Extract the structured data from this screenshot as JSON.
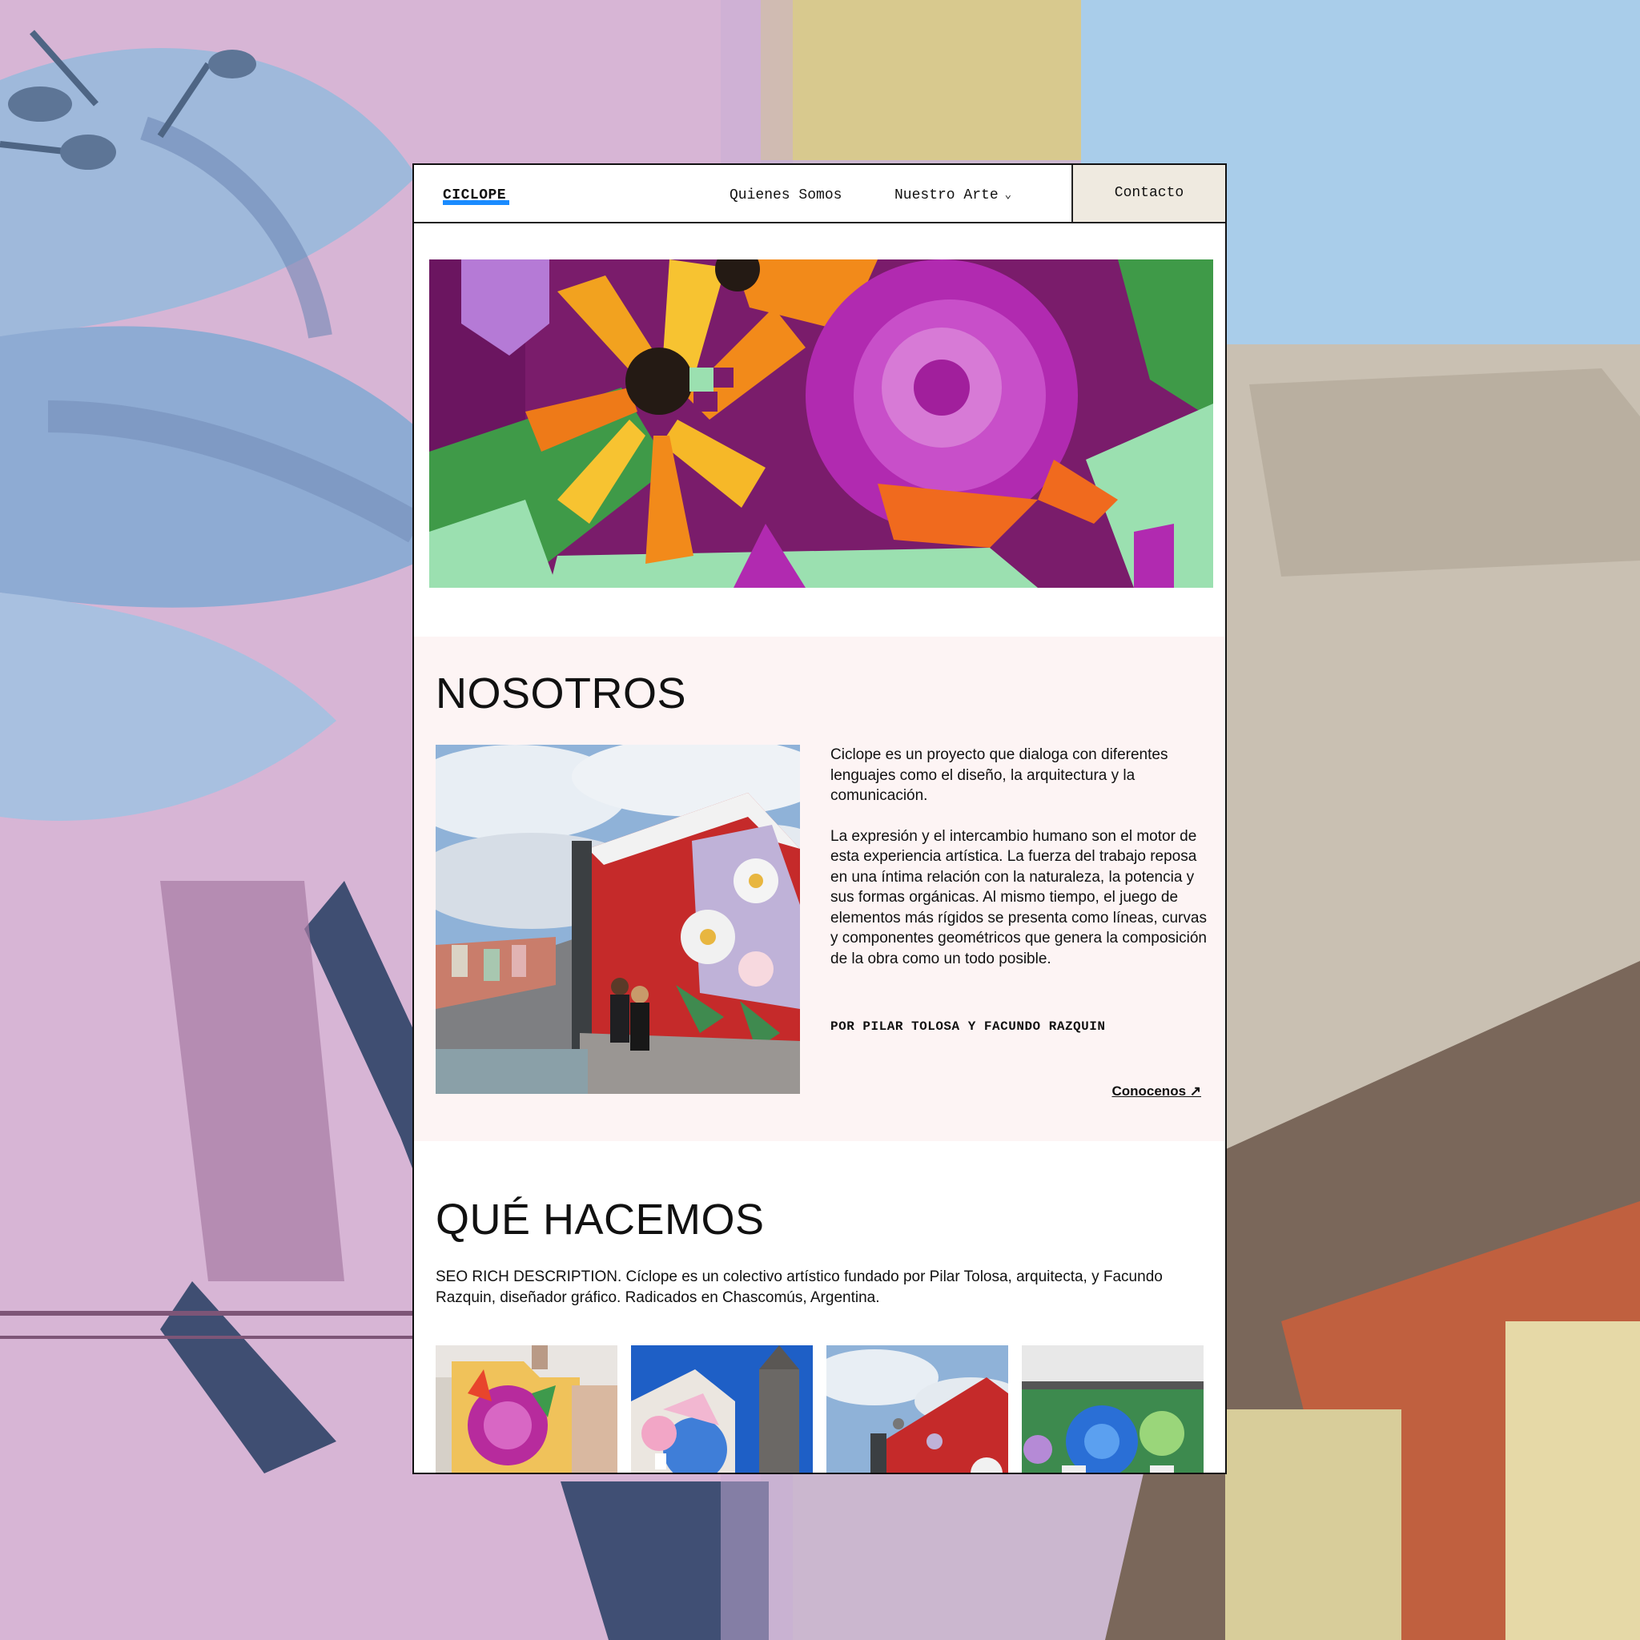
{
  "header": {
    "logo": "CICLOPE",
    "nav": {
      "quienes": "Quienes Somos",
      "arte": "Nuestro Arte",
      "contacto": "Contacto"
    }
  },
  "nosotros": {
    "title": "NOSOTROS",
    "paragraph_1": "Ciclope es un proyecto que dialoga con diferentes lenguajes como el diseño, la arquitectura y la comunicación.",
    "paragraph_2": "La expresión y el intercambio humano son el motor de esta experiencia artística. La fuerza del trabajo reposa en una íntima relación con la naturaleza, la potencia y sus formas orgánicas. Al mismo tiempo, el juego de elementos más rígidos se presenta como líneas, curvas y componentes geométricos que genera la composición de la obra como un todo posible.",
    "byline": "POR PILAR TOLOSA Y FACUNDO RAZQUIN",
    "cta": "Conocenos ↗"
  },
  "que_hacemos": {
    "title": "QUÉ HACEMOS",
    "description": "SEO RICH DESCRIPTION. Cíclope es un colectivo artístico fundado por Pilar Tolosa, arquitecta, y Facundo Razquin, diseñador gráfico. Radicados en Chascomús, Argentina."
  },
  "colors": {
    "accent": "#1a8bff",
    "contact_bg": "#efeae0",
    "section_bg": "#fdf4f4"
  },
  "icons": {
    "nav_arte": "chevron-down-icon",
    "cta": "arrow-up-right-icon"
  }
}
